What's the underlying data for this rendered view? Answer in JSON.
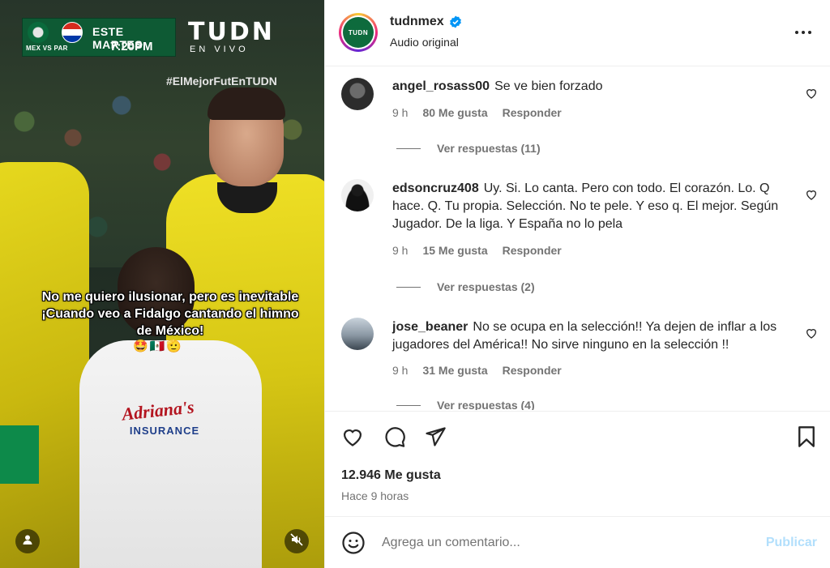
{
  "video": {
    "scoreboard": {
      "teams": "MEX  VS  PAR",
      "day": "ESTE MARTES",
      "time": "7:20PM"
    },
    "broadcaster": "TUDN",
    "broadcaster_sub": "EN VIVO",
    "hashtag": "#ElMejorFutEnTUDN",
    "caption": "No me quiero ilusionar, pero es inevitable ¡Cuando veo a Fidalgo cantando el himno de México!",
    "caption_emoji": "🤩🇲🇽🫡",
    "shirt_brand": "Adriana's",
    "shirt_sub": "INSURANCE",
    "profile_icon": "user-icon",
    "mute_icon": "speaker-muted-icon"
  },
  "header": {
    "avatar_text": "TUDN",
    "username": "tudnmex",
    "subtitle": "Audio original",
    "more_icon": "more-horizontal-icon",
    "verified_icon": "verified-badge-icon"
  },
  "comments": [
    {
      "username": "angel_rosass00",
      "text": "Se ve bien forzado",
      "time": "9 h",
      "likes": "80 Me gusta",
      "reply": "Responder",
      "view_replies": "Ver respuestas (11)"
    },
    {
      "username": "edsoncruz408",
      "text": "Uy. Si. Lo canta. Pero con todo. El corazón. Lo. Q hace. Q. Tu propia. Selección. No te pele. Y eso q. El mejor. Según Jugador. De la liga. Y España no lo pela",
      "time": "9 h",
      "likes": "15 Me gusta",
      "reply": "Responder",
      "view_replies": "Ver respuestas (2)"
    },
    {
      "username": "jose_beaner",
      "text": "No se ocupa en la selección!! Ya dejen de inflar a los jugadores del América!! No sirve ninguno en la selección !!",
      "time": "9 h",
      "likes": "31 Me gusta",
      "reply": "Responder",
      "view_replies": "Ver respuestas (4)"
    }
  ],
  "actions": {
    "like_icon": "heart-icon",
    "comment_icon": "comment-icon",
    "share_icon": "send-icon",
    "save_icon": "bookmark-icon",
    "likes_count": "12.946 Me gusta",
    "time_ago": "Hace 9 horas"
  },
  "composer": {
    "emoji_icon": "smiley-icon",
    "placeholder": "Agrega un comentario...",
    "value": "",
    "publish_label": "Publicar"
  },
  "colors": {
    "brand_green": "#0e6b3d",
    "publish_disabled": "#b2dffc",
    "verified_blue": "#0095f6",
    "muted_text": "#737373"
  }
}
